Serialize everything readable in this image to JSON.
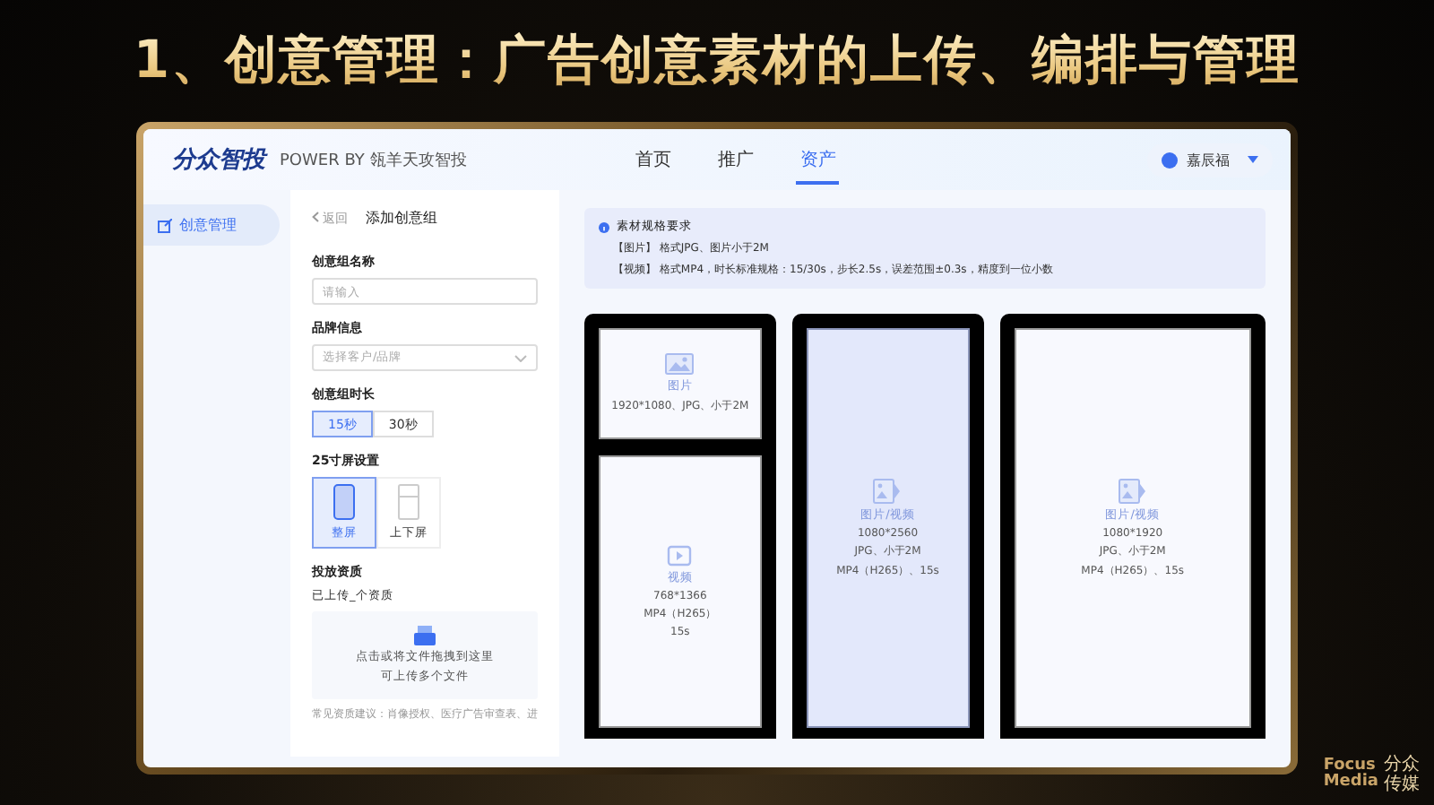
{
  "slide_title": "1、创意管理：广告创意素材的上传、编排与管理",
  "header": {
    "logo": "分众智投",
    "powered_by": "POWER BY 瓴羊天攻智投",
    "nav": [
      {
        "label": "首页",
        "selected": false
      },
      {
        "label": "推广",
        "selected": false
      },
      {
        "label": "资产",
        "selected": true
      }
    ],
    "user": "嘉辰福"
  },
  "sidebar": {
    "items": [
      {
        "label": "创意管理",
        "selected": true
      }
    ]
  },
  "form": {
    "back": "返回",
    "title": "添加创意组",
    "name_field": {
      "label": "创意组名称",
      "placeholder": "请输入"
    },
    "brand_field": {
      "label": "品牌信息",
      "placeholder": "选择客户/品牌"
    },
    "duration": {
      "label": "创意组时长",
      "options": [
        {
          "label": "15秒",
          "selected": true
        },
        {
          "label": "30秒",
          "selected": false
        }
      ]
    },
    "screen_setting": {
      "label": "25寸屏设置",
      "options": [
        {
          "label": "整屏",
          "kind": "full",
          "selected": true
        },
        {
          "label": "上下屏",
          "kind": "split",
          "selected": false
        }
      ]
    },
    "qualification": {
      "label": "投放资质",
      "count": "已上传_个资质",
      "upload_text": "点击或将文件拖拽到这里",
      "upload_hint": "可上传多个文件",
      "tip": "常见资质建议：肖像授权、医疗广告审查表、进"
    }
  },
  "spec_notice": {
    "title": "素材规格要求",
    "lines": [
      "【图片】 格式JPG、图片小于2M",
      "【视频】 格式MP4，时长标准规格：15/30s，步长2.5s，误差范围±0.3s，精度到一位小数"
    ]
  },
  "screens": [
    {
      "highlighted": false,
      "slots": [
        {
          "kind": "image",
          "label": "图片",
          "specs": [
            "1920*1080、JPG、小于2M"
          ]
        },
        {
          "kind": "video",
          "label": "视频",
          "specs": [
            "768*1366",
            "MP4（H265）",
            "15s"
          ]
        }
      ]
    },
    {
      "highlighted": true,
      "slots": [
        {
          "kind": "media",
          "label": "图片/视频",
          "specs": [
            "1080*2560",
            "JPG、小于2M",
            "MP4（H265）、15s"
          ]
        }
      ]
    },
    {
      "highlighted": false,
      "slots": [
        {
          "kind": "media",
          "label": "图片/视频",
          "specs": [
            "1080*1920",
            "JPG、小于2M",
            "MP4（H265）、15s"
          ]
        }
      ]
    }
  ],
  "brand_mark": {
    "latin": [
      "Focus",
      "Media"
    ],
    "chinese": [
      "分众",
      "传媒"
    ]
  }
}
